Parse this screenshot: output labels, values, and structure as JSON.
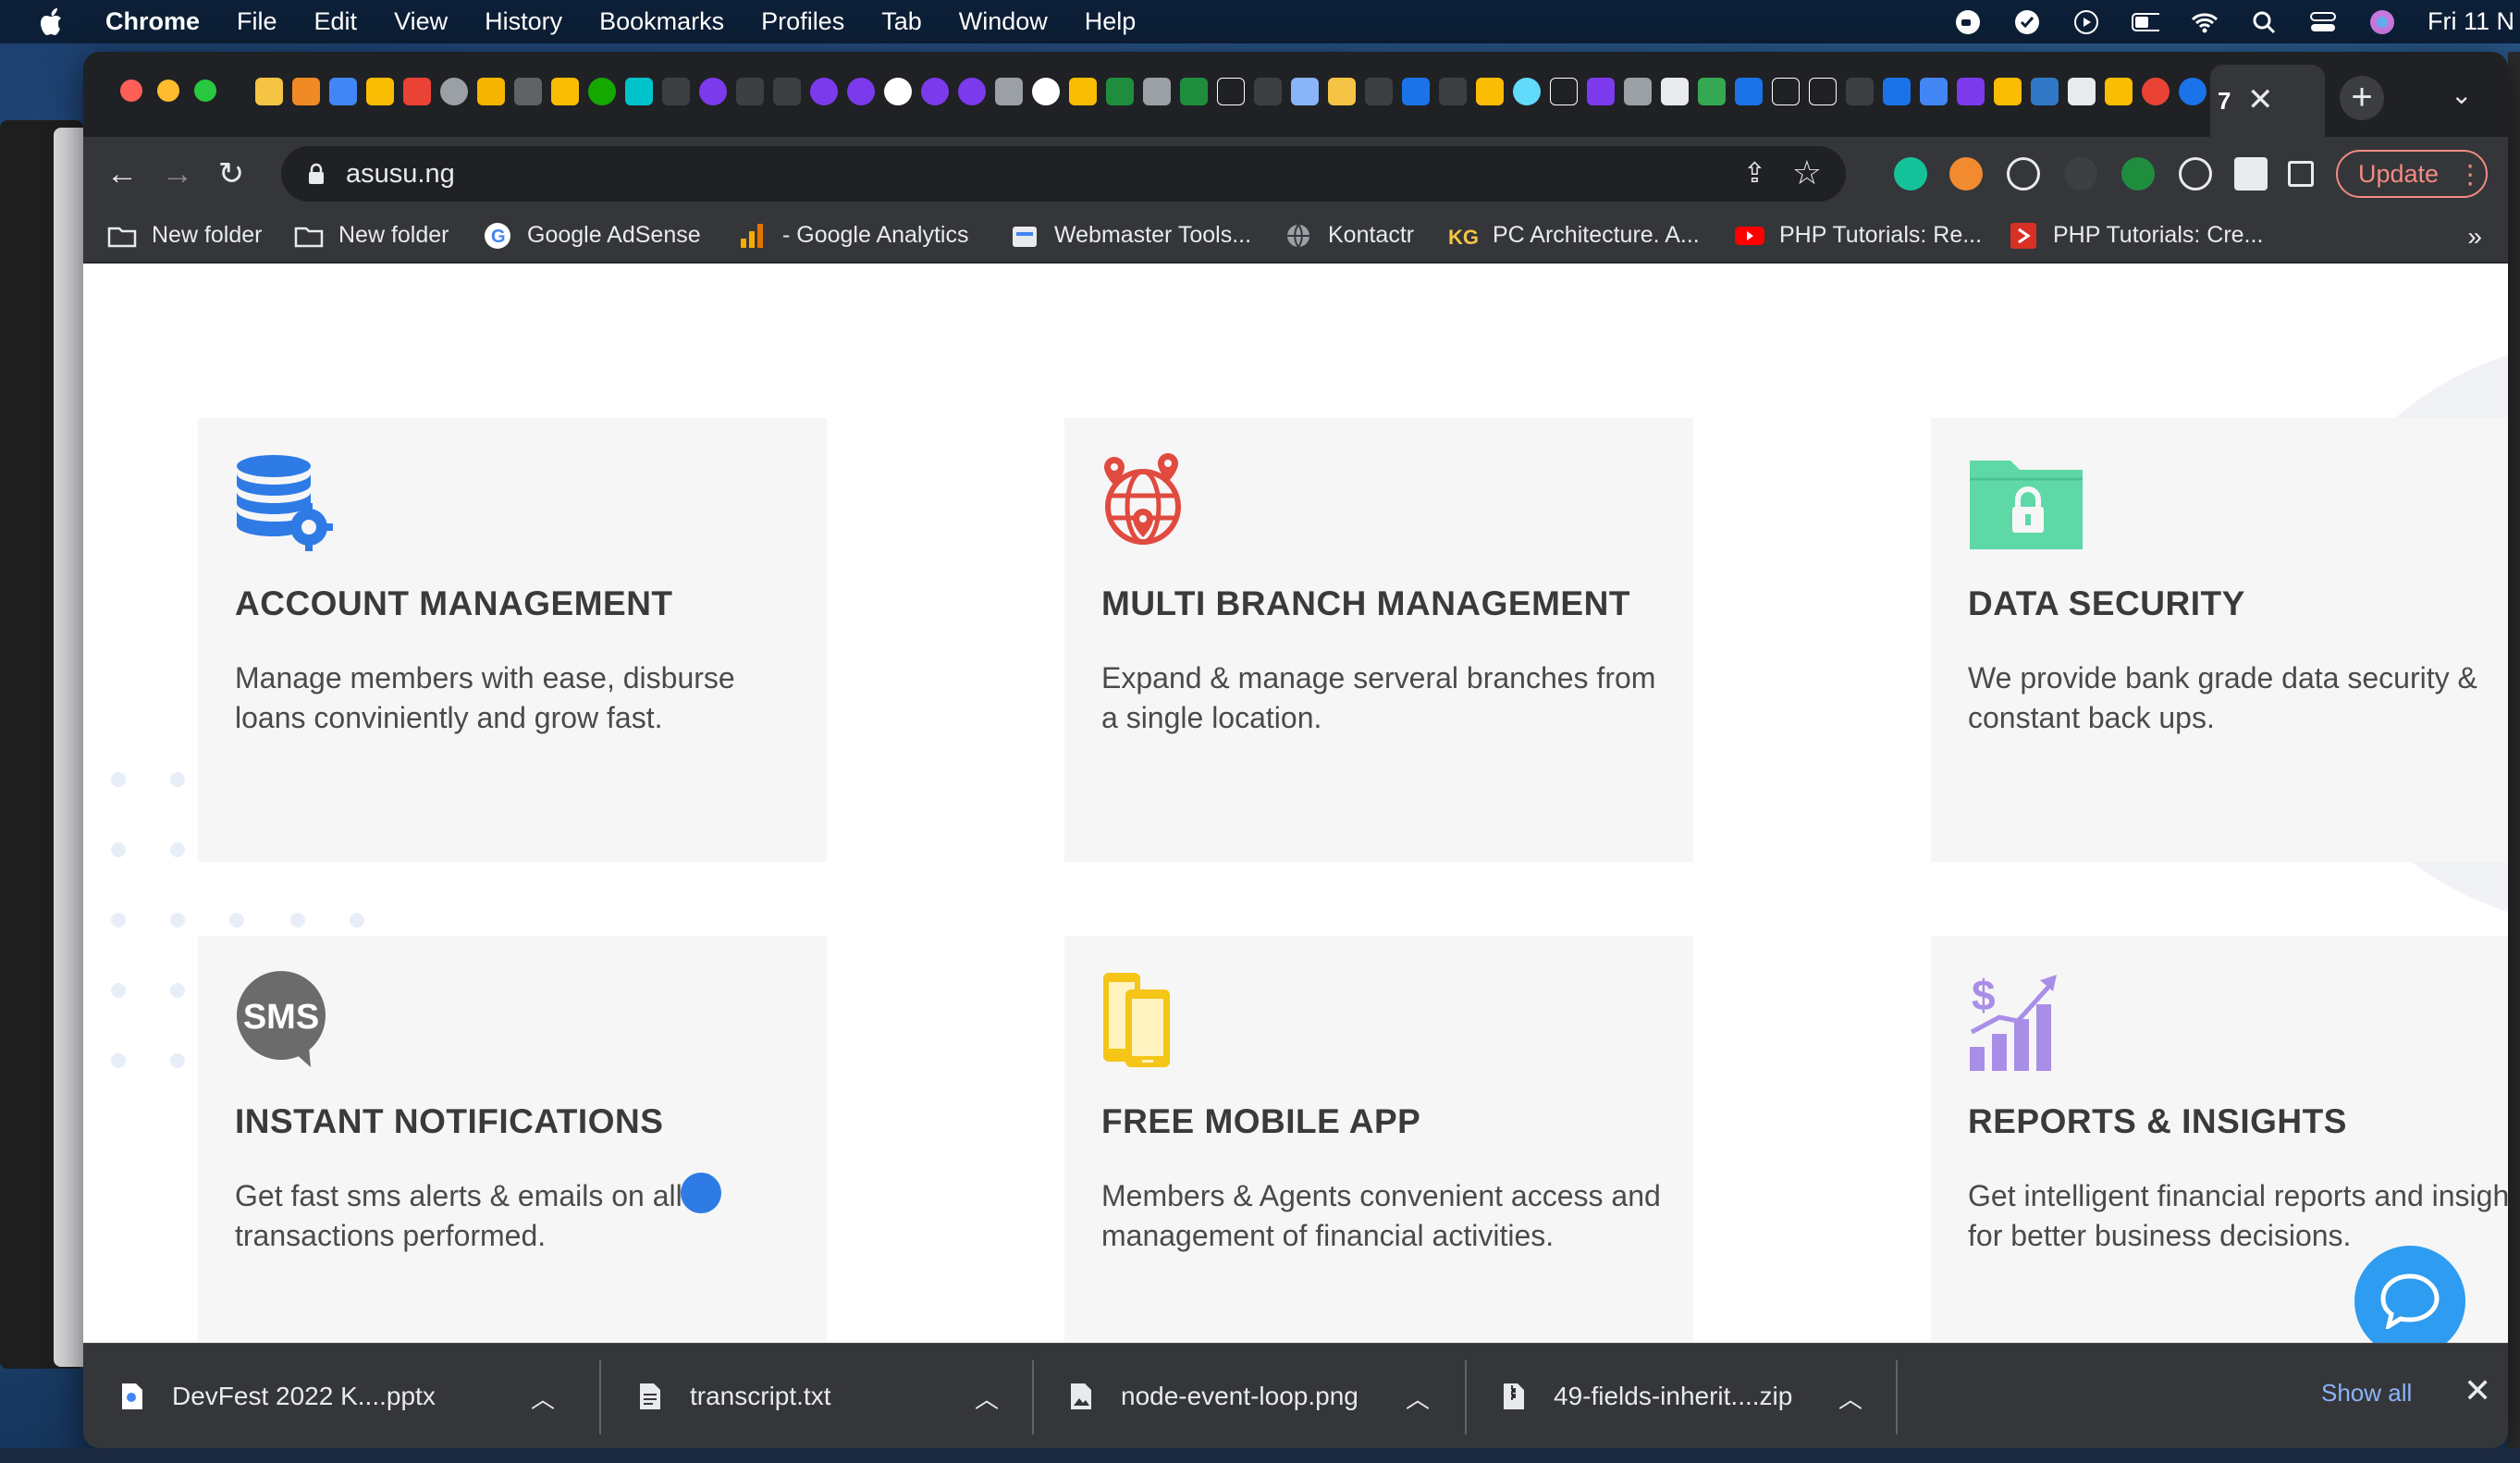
{
  "menubar": {
    "app": "Chrome",
    "items": [
      "File",
      "Edit",
      "View",
      "History",
      "Bookmarks",
      "Profiles",
      "Tab",
      "Window",
      "Help"
    ],
    "clock": "Fri 11 N"
  },
  "tab": {
    "close_icon": "close-icon"
  },
  "toolbar": {
    "url": "asusu.ng",
    "update_label": "Update"
  },
  "bookmarks": [
    {
      "label": "New folder",
      "icon": "folder-icon"
    },
    {
      "label": "New folder",
      "icon": "folder-icon"
    },
    {
      "label": "Google AdSense",
      "icon": "google-icon"
    },
    {
      "label": "- Google Analytics",
      "icon": "analytics-icon"
    },
    {
      "label": "Webmaster Tools...",
      "icon": "webmaster-icon"
    },
    {
      "label": "Kontactr",
      "icon": "globe-icon"
    },
    {
      "label": "PC Architecture. A...",
      "icon": "kg-icon"
    },
    {
      "label": "PHP Tutorials: Re...",
      "icon": "youtube-icon"
    },
    {
      "label": "PHP Tutorials: Cre...",
      "icon": "tutorial-icon"
    }
  ],
  "features": [
    {
      "title": "ACCOUNT MANAGEMENT",
      "desc": "Manage members with ease, disburse loans conviniently and grow fast.",
      "icon": "database-gear-icon",
      "color": "#2f7be6"
    },
    {
      "title": "MULTI BRANCH MANAGEMENT",
      "desc": "Expand & manage serveral branches from a single location.",
      "icon": "globe-pin-icon",
      "color": "#e04a3f"
    },
    {
      "title": "DATA SECURITY",
      "desc": "We provide bank grade data security & constant back ups.",
      "icon": "folder-lock-icon",
      "color": "#5fd8a8"
    },
    {
      "title": "INSTANT NOTIFICATIONS",
      "desc": "Get fast sms alerts & emails on all transactions performed.",
      "icon": "sms-bubble-icon",
      "color": "#6b6b6b",
      "icon_text": "SMS"
    },
    {
      "title": "FREE MOBILE APP",
      "desc": "Members & Agents convenient access and management of financial activities.",
      "icon": "mobile-devices-icon",
      "color": "#f5c518"
    },
    {
      "title": "REPORTS & INSIGHTS",
      "desc": "Get intelligent financial reports and insights for better business decisions.",
      "icon": "growth-chart-icon",
      "color": "#a98ee8"
    }
  ],
  "downloads": {
    "items": [
      "DevFest 2022 K....pptx",
      "transcript.txt",
      "node-event-loop.png",
      "49-fields-inherit....zip"
    ],
    "show_all": "Show all"
  }
}
